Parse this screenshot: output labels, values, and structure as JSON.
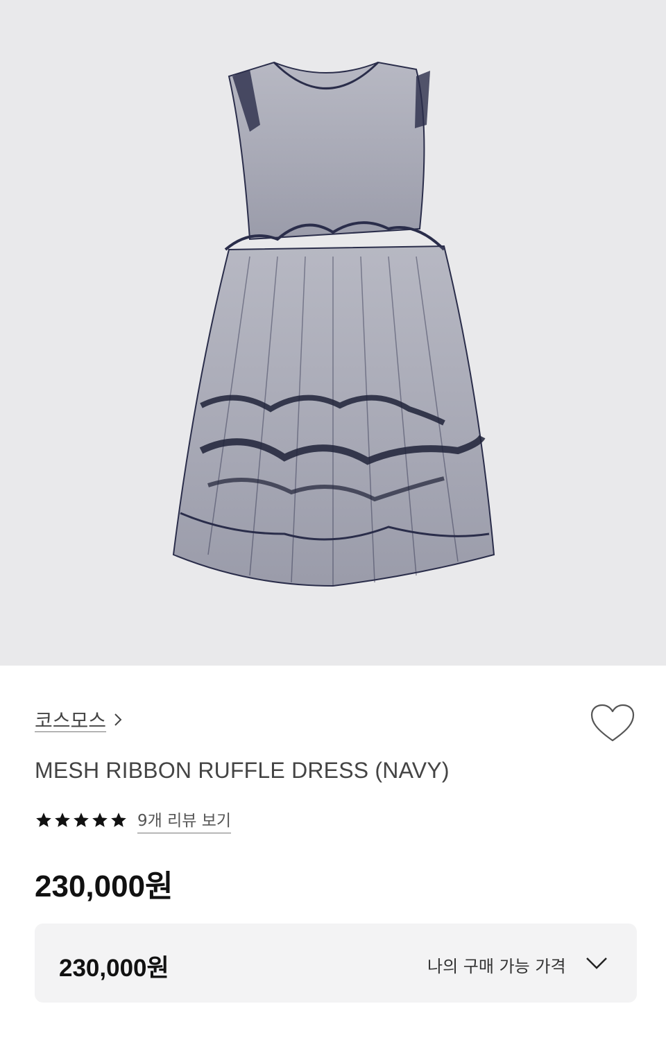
{
  "product_image": {
    "alt_name": "mesh-ribbon-ruffle-dress-image",
    "dress_color": "#2a2d4a",
    "background": "#e9e9eb"
  },
  "brand": {
    "name": "코스모스",
    "chevron_icon": "chevron-right-icon"
  },
  "wishlist": {
    "icon": "heart-outline-icon"
  },
  "product": {
    "title": "MESH RIBBON RUFFLE DRESS (NAVY)"
  },
  "rating": {
    "stars": 5,
    "max_stars": 5,
    "review_link": "9개 리뷰 보기"
  },
  "price": {
    "amount": "230,000원"
  },
  "my_price": {
    "amount": "230,000원",
    "label": "나의 구매 가능 가격",
    "icon": "chevron-down-icon"
  }
}
